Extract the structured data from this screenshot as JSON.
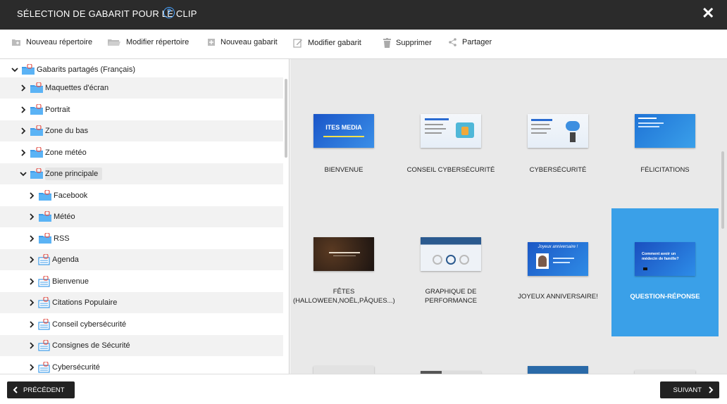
{
  "dialog": {
    "title": "SÉLECTION DE GABARIT POUR LE CLIP",
    "help_glyph": "?",
    "close_glyph": "✕"
  },
  "toolbar": {
    "new_folder": "Nouveau répertoire",
    "edit_folder": "Modifier répertoire",
    "new_template": "Nouveau gabarit",
    "edit_template": "Modifier gabarit",
    "delete": "Supprimer",
    "share": "Partager"
  },
  "tree": {
    "root": "Gabarits partagés (Français)",
    "items": [
      {
        "label": "Maquettes d'écran"
      },
      {
        "label": "Portrait"
      },
      {
        "label": "Zone du bas"
      },
      {
        "label": "Zone météo"
      },
      {
        "label": "Zone principale"
      },
      {
        "label": "Facebook"
      },
      {
        "label": "Météo"
      },
      {
        "label": "RSS"
      },
      {
        "label": "Agenda"
      },
      {
        "label": "Bienvenue"
      },
      {
        "label": "Citations Populaire"
      },
      {
        "label": "Conseil cybersécurité"
      },
      {
        "label": "Consignes de Sécurité"
      },
      {
        "label": "Cybersécurité"
      }
    ]
  },
  "templates": [
    {
      "label": "BIENVENUE",
      "thumb_text": "ITES MEDIA"
    },
    {
      "label": "CONSEIL CYBERSÉCURITÉ",
      "thumb_text": ""
    },
    {
      "label": "CYBERSÉCURITÉ",
      "thumb_text": ""
    },
    {
      "label": "FÉLICITATIONS",
      "thumb_text": ""
    },
    {
      "label": "FÊTES (HALLOWEEN,NOËL,PÂQUES...)",
      "thumb_text": ""
    },
    {
      "label": "GRAPHIQUE DE PERFORMANCE",
      "thumb_text": ""
    },
    {
      "label": "JOYEUX ANNIVERSAIRE!",
      "thumb_text": "Joyeux anniversaire !"
    },
    {
      "label": "QUESTION-RÉPONSE",
      "thumb_text": "Comment avoir un médecin de famille?"
    }
  ],
  "footer": {
    "prev": "PRÉCÉDENT",
    "next": "SUIVANT"
  },
  "colors": {
    "accent": "#3aa0e8",
    "titlebar": "#2b2b2b",
    "folder_blue": "#3d9be9",
    "lock_red": "#e2534b"
  }
}
